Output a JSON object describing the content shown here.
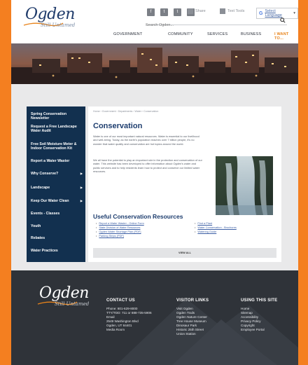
{
  "brand": {
    "logo_text": "Ogden",
    "tagline": "Still Untamed"
  },
  "header": {
    "social_icons": [
      "facebook-icon",
      "twitter-icon",
      "twitter-icon",
      "instagram-icon"
    ],
    "share_label": "Share",
    "text_tools_label": "Text Tools",
    "language_label": "Select Language",
    "search_placeholder": "Search Ogden...",
    "nav": [
      {
        "label": "GOVERNMENT"
      },
      {
        "label": "COMMUNITY"
      },
      {
        "label": "SERVICES"
      },
      {
        "label": "BUSINESS"
      },
      {
        "label": "I WANT TO..."
      }
    ]
  },
  "colors": {
    "frame": "#f47f20",
    "sidebar": "#12304f",
    "heading": "#1d3d6e",
    "link": "#3c5fa5",
    "footer": "#2f3339",
    "want_to": "#e8831a"
  },
  "sidebar": {
    "items": [
      {
        "label": "Spring Conservation Newsletter",
        "arrow": ""
      },
      {
        "label": "Request a Free Landscape Water Audit",
        "arrow": ""
      },
      {
        "label": "Free Soil Moisture Meter & Indoor Conservation Kit",
        "arrow": ""
      },
      {
        "label": "Report a Water Waster",
        "arrow": ""
      },
      {
        "label": "Why Conserve?",
        "arrow": "▶"
      },
      {
        "label": "Landscape",
        "arrow": "▶"
      },
      {
        "label": "Keep Our Water Clean",
        "arrow": "▶"
      },
      {
        "label": "Events - Classes",
        "arrow": ""
      },
      {
        "label": "Youth",
        "arrow": ""
      },
      {
        "label": "Rebates",
        "arrow": ""
      },
      {
        "label": "Water Practices",
        "arrow": ""
      }
    ]
  },
  "content": {
    "breadcrumb": "Home › Government › Departments › Water › Conservation",
    "title": "Conservation",
    "paragraph1": "Water is one of our most important natural resources. Water is essential to our livelihood and well-being. Today, as the earth's population reaches over 7 billion people, it's no wonder that water quality and conservation are hot topics around the world.",
    "paragraph2": "We all have the potential to play an important role in the protection and conservation of our water. This website has been developed to offer information about Ogden's water and public services and to help residents learn how to protect and conserve our limited water resources.",
    "resources_title": "Useful Conservation Resources",
    "resources_left": [
      "Report a Water Waster - Online Form",
      "State Division of Water Resources",
      "Ogden Water Shortage Plan (PDF)",
      "Parking Strips (PDF)"
    ],
    "resources_right": [
      "Find a Plant",
      "Water Conservation - Brochures",
      "Watering Guide"
    ],
    "view_all": "VIEW ALL"
  },
  "footer": {
    "contact": {
      "heading": "CONTACT US",
      "lines": [
        "Phone: 801-629-8000",
        "TTY/TDD: 711 or 888-735-5906",
        "Email",
        "2549 Washington Blvd",
        "Ogden, UT 84401",
        "Media Room"
      ]
    },
    "visitor": {
      "heading": "VISITOR LINKS",
      "lines": [
        "Visit Ogden",
        "Ogden Trails",
        "Ogden Nature Center",
        "Tree House Museum",
        "Dinosaur Park",
        "Historic 25th Street",
        "Union Station"
      ]
    },
    "site": {
      "heading": "USING THIS SITE",
      "lines": [
        "Home",
        "Sitemap",
        "Accessibility",
        "Privacy Policy",
        "Copyright",
        "Employee Portal"
      ]
    }
  }
}
